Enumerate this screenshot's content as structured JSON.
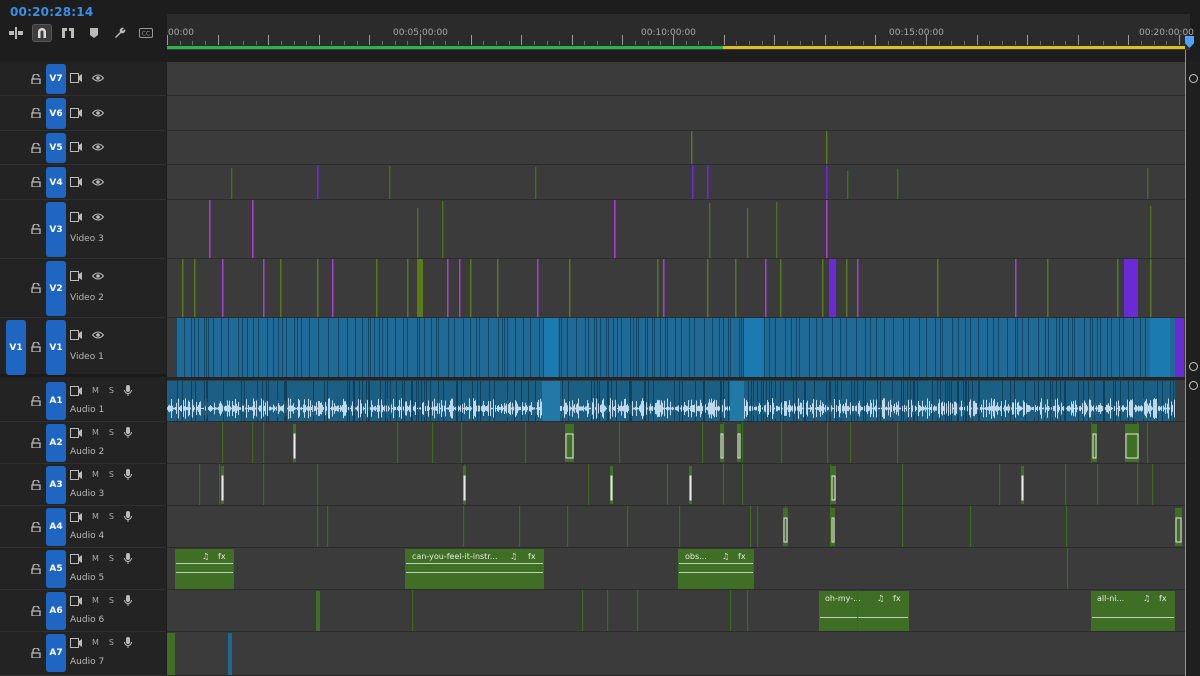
{
  "timecode": "00:20:28:14",
  "toolbar": [
    {
      "name": "insert-nest-icon",
      "active": false
    },
    {
      "name": "snap-magnet-icon",
      "active": true
    },
    {
      "name": "linked-selection-icon",
      "active": false
    },
    {
      "name": "add-marker-icon",
      "active": false
    },
    {
      "name": "wrench-settings-icon",
      "active": false
    },
    {
      "name": "captions-icon",
      "active": false
    }
  ],
  "ruler": {
    "labels": [
      "00:00",
      "00:05:00:00",
      "00:10:00:00",
      "00:15:00:00",
      "00:20:00:00"
    ]
  },
  "colors": {
    "video_clip": "#1f6a96",
    "purple_clip": "#6a2ad6",
    "green_clip": "#3f6e25",
    "olive_clip": "#5c7a16",
    "accent": "#1f66c2"
  },
  "video_tracks": [
    {
      "id": "V7",
      "name": "",
      "source": ""
    },
    {
      "id": "V6",
      "name": "",
      "source": ""
    },
    {
      "id": "V5",
      "name": "",
      "source": ""
    },
    {
      "id": "V4",
      "name": "",
      "source": ""
    },
    {
      "id": "V3",
      "name": "Video 3",
      "source": ""
    },
    {
      "id": "V2",
      "name": "Video 2",
      "source": ""
    },
    {
      "id": "V1",
      "name": "Video 1",
      "source": "V1"
    }
  ],
  "audio_tracks": [
    {
      "id": "A1",
      "name": "Audio 1",
      "m": "M",
      "s": "S"
    },
    {
      "id": "A2",
      "name": "Audio 2",
      "m": "M",
      "s": "S"
    },
    {
      "id": "A3",
      "name": "Audio 3",
      "m": "M",
      "s": "S"
    },
    {
      "id": "A4",
      "name": "Audio 4",
      "m": "M",
      "s": "S"
    },
    {
      "id": "A5",
      "name": "Audio 5",
      "m": "M",
      "s": "S"
    },
    {
      "id": "A6",
      "name": "Audio 6",
      "m": "M",
      "s": "S"
    },
    {
      "id": "A7",
      "name": "Audio 7",
      "m": "M",
      "s": "S"
    }
  ],
  "audio_clip_labels": {
    "a5_clip2": "can-you-feel-it-instr...",
    "a5_clip3": "obs...",
    "a6_clip1": "oh-my-...",
    "a6_clip2": "all-ni..."
  },
  "clip_badges": {
    "music": "♫",
    "fx": "fx"
  }
}
